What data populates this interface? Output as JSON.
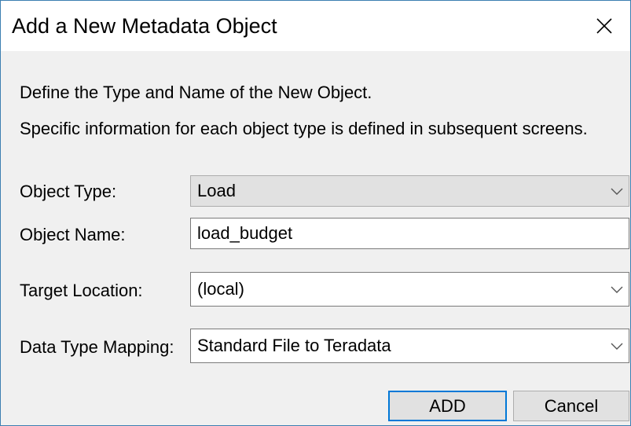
{
  "window": {
    "title": "Add a New Metadata Object"
  },
  "intro": {
    "line1": "Define the Type and Name of the New Object.",
    "line2": "Specific information for each object type is defined in subsequent screens."
  },
  "form": {
    "object_type_label": "Object Type:",
    "object_type_value": "Load",
    "object_name_label": "Object Name:",
    "object_name_value": "load_budget",
    "target_location_label": "Target Location:",
    "target_location_value": "(local)",
    "data_type_mapping_label": "Data Type Mapping:",
    "data_type_mapping_value": "Standard File to Teradata"
  },
  "buttons": {
    "add_label": "ADD",
    "cancel_label": "Cancel"
  },
  "icons": {
    "close": "close-icon",
    "dropdown": "chevron-down-icon"
  },
  "colors": {
    "window_border": "#3c7fb1",
    "dialog_background": "#f0f0f0",
    "default_button_border": "#0078d7"
  }
}
